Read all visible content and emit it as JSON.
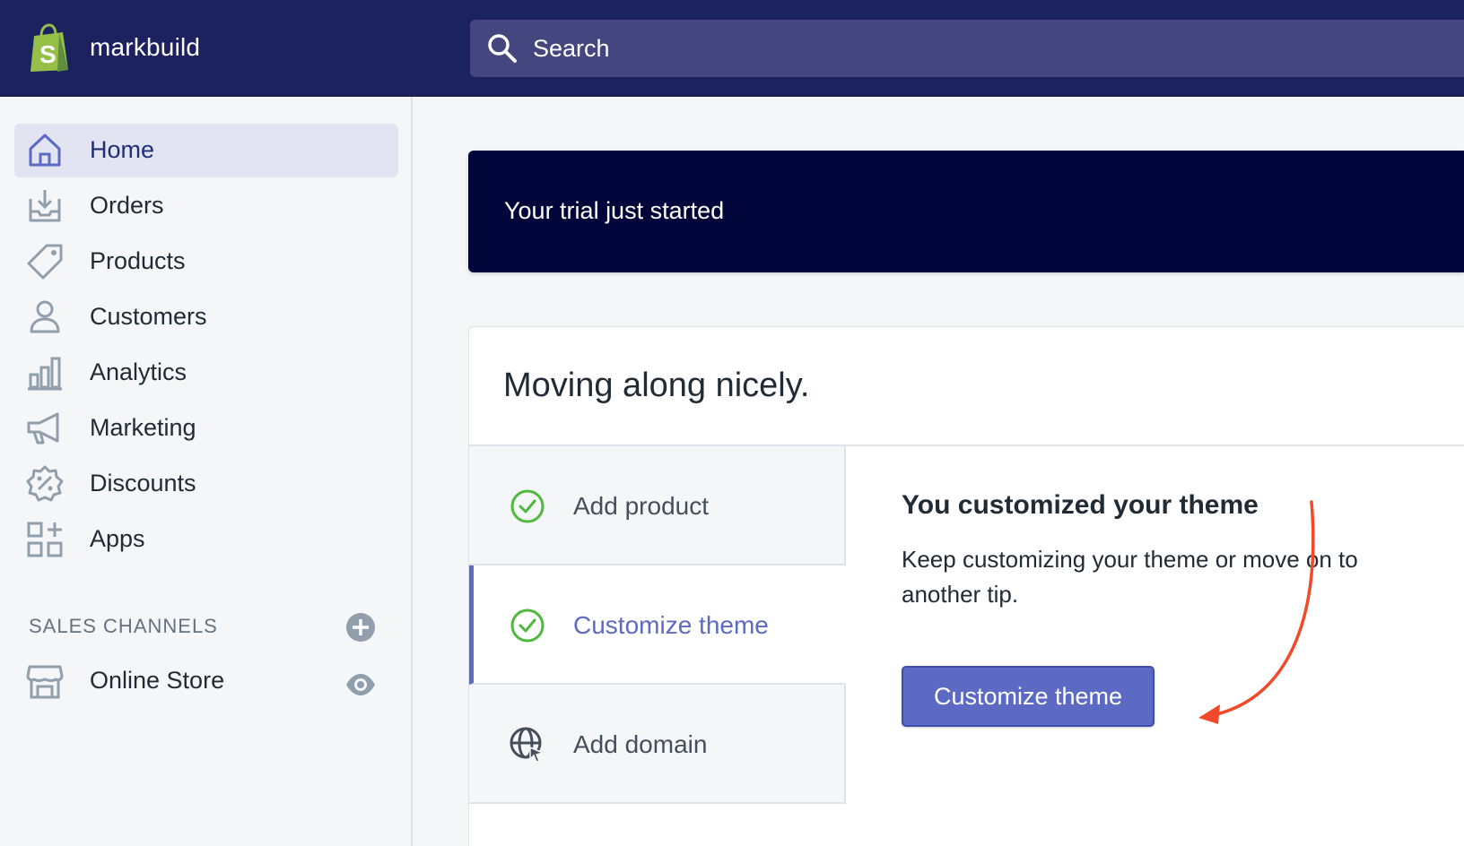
{
  "header": {
    "store_name": "markbuild",
    "search_placeholder": "Search",
    "logo_icon": "shopify-bag-icon",
    "brand_color": "#1c2260",
    "logo_color": "#95bf47"
  },
  "sidebar": {
    "items": [
      {
        "label": "Home",
        "icon": "home-icon",
        "active": true
      },
      {
        "label": "Orders",
        "icon": "orders-inbox-icon"
      },
      {
        "label": "Products",
        "icon": "tag-icon"
      },
      {
        "label": "Customers",
        "icon": "person-icon"
      },
      {
        "label": "Analytics",
        "icon": "bar-chart-icon"
      },
      {
        "label": "Marketing",
        "icon": "megaphone-icon"
      },
      {
        "label": "Discounts",
        "icon": "discount-badge-icon"
      },
      {
        "label": "Apps",
        "icon": "apps-grid-icon"
      }
    ],
    "sales_channels_title": "SALES CHANNELS",
    "channels": [
      {
        "label": "Online Store",
        "icon": "store-icon"
      }
    ]
  },
  "main": {
    "trial_banner": "Your trial just started",
    "card": {
      "title": "Moving along nicely.",
      "steps": [
        {
          "label": "Add product",
          "icon": "check-circle-icon",
          "done": true
        },
        {
          "label": "Customize theme",
          "icon": "check-circle-icon",
          "done": true,
          "active": true
        },
        {
          "label": "Add domain",
          "icon": "globe-icon",
          "done": false
        }
      ],
      "detail_title": "You customized your theme",
      "detail_desc": "Keep customizing your theme or move on to another tip.",
      "button_label": "Customize theme"
    },
    "accent_color": "#5c6ac4",
    "success_color": "#50b83c",
    "annotation_color": "#f2492a"
  }
}
